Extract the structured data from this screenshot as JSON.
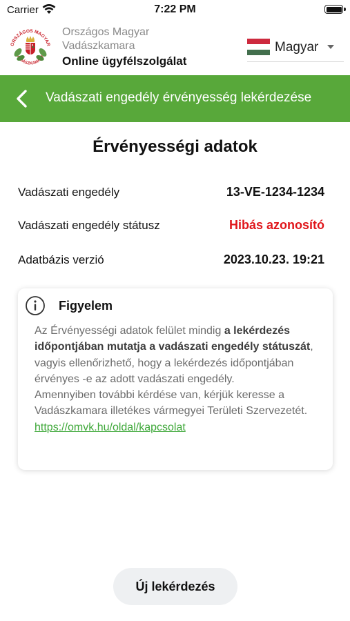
{
  "status_bar": {
    "carrier": "Carrier",
    "time": "7:22 PM",
    "battery_level_percent": 100,
    "wifi_icon": "wifi-icon",
    "battery_icon": "battery-icon"
  },
  "header": {
    "logo_text_top": "ORSZÁGOS MAGYAR",
    "logo_text_bottom": "VADÁSZKAMARA",
    "org_name": "Országos Magyar Vadászkamara",
    "service_name": "Online ügyfélszolgálat",
    "language": {
      "label": "Magyar",
      "flag_colors": [
        "#cd2a3e",
        "#ffffff",
        "#436f4d"
      ],
      "caret_icon": "caret-down-icon"
    }
  },
  "nav": {
    "back_icon": "chevron-left-icon",
    "title": "Vadászati engedély érvényesség lekérdezése",
    "background_color": "#58a83a"
  },
  "content": {
    "title": "Érvényességi adatok",
    "rows": [
      {
        "label": "Vadászati engedély",
        "value": "13-VE-1234-1234"
      },
      {
        "label": "Vadászati engedély státusz",
        "value": "Hibás azonosító",
        "value_color": "#e0161b"
      },
      {
        "label": "Adatbázis verzió",
        "value": "2023.10.23. 19:21"
      }
    ]
  },
  "notice": {
    "icon": "info-icon",
    "title": "Figyelem",
    "text_1": "Az Érvényességi adatok felület mindig ",
    "text_bold": "a lekérdezés időpontjában mutatja a vadászati engedély státuszát",
    "text_2": ", vagyis ellenőrizhető, hogy a lekérdezés időpontjában érvényes -e az adott vadászati engedély.",
    "text_3": "Amennyiben további kérdése van, kérjük keresse a Vadászkamara illetékes vármegyei Területi Szervezetét. ",
    "link_text": "https://omvk.hu/oldal/kapcsolat",
    "link_color": "#3fa83a"
  },
  "footer": {
    "new_query_label": "Új lekérdezés"
  }
}
